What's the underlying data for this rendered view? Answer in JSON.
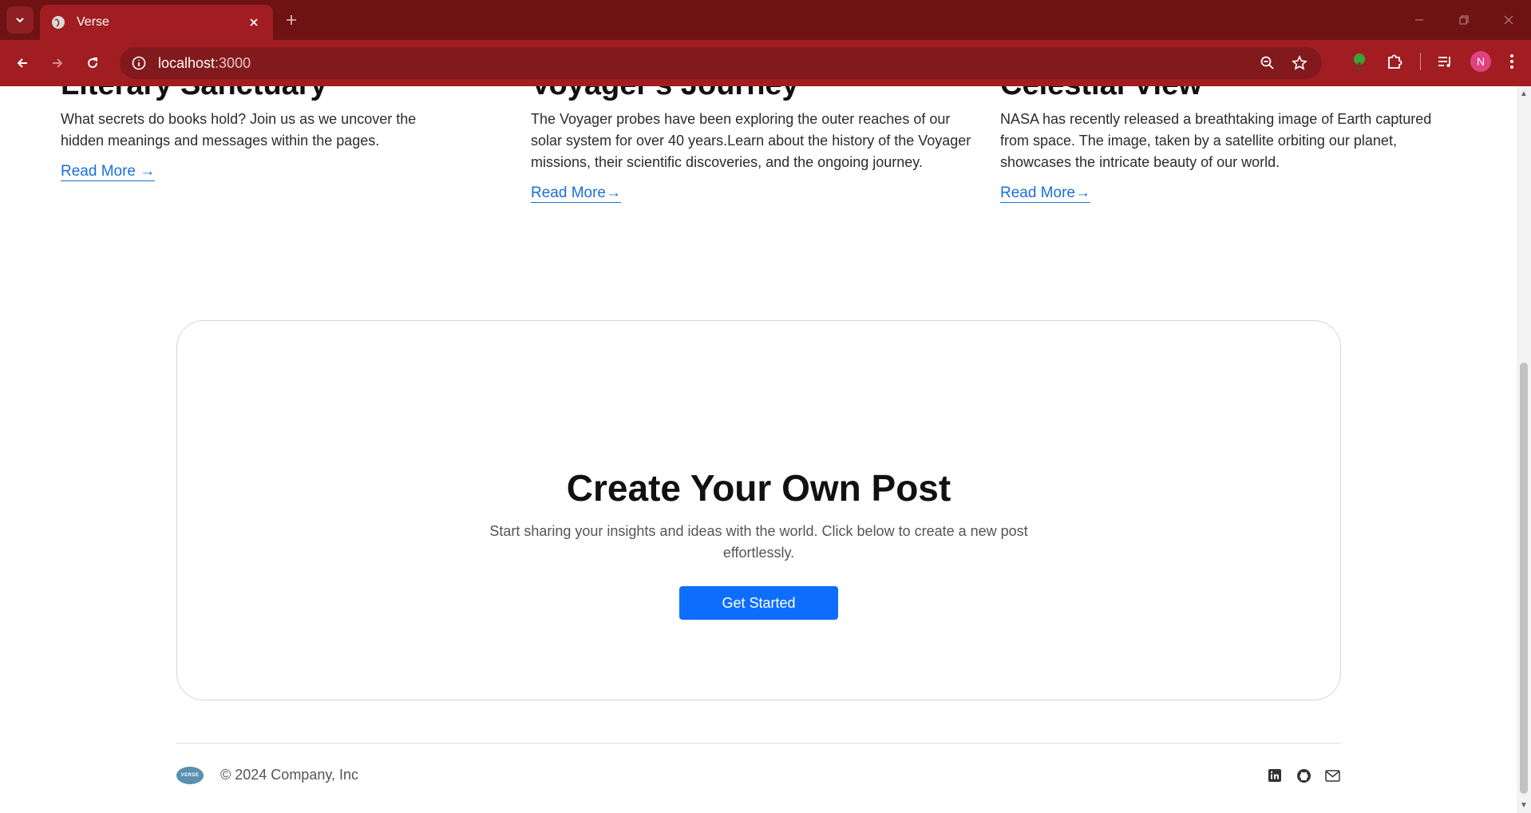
{
  "browser": {
    "tab_title": "Verse",
    "url_host": "localhost",
    "url_port": ":3000",
    "profile_initial": "N",
    "accent_color": "#a11d21"
  },
  "cards": [
    {
      "title": "Literary Sanctuary",
      "description": "What secrets do books hold? Join us as we uncover the hidden meanings and messages within the pages.",
      "link": "Read More →"
    },
    {
      "title": "Voyager's Journey",
      "description": "The Voyager probes have been exploring the outer reaches of our solar system for over 40 years.Learn about the history of the Voyager missions, their scientific discoveries, and the ongoing journey.",
      "link": "Read More→"
    },
    {
      "title": "Celestial View",
      "description": "NASA has recently released a breathtaking image of Earth captured from space. The image, taken by a satellite orbiting our planet, showcases the intricate beauty of our world.",
      "link": "Read More→"
    }
  ],
  "cta": {
    "title": "Create Your Own Post",
    "subtitle": "Start sharing your insights and ideas with the world. Click below to create a new post effortlessly.",
    "button_label": "Get Started",
    "button_color": "#0d6efd"
  },
  "footer": {
    "logo_text": "VERSE",
    "copyright": "© 2024 Company, Inc",
    "social_icons": [
      "linkedin-icon",
      "github-icon",
      "mail-icon"
    ]
  }
}
